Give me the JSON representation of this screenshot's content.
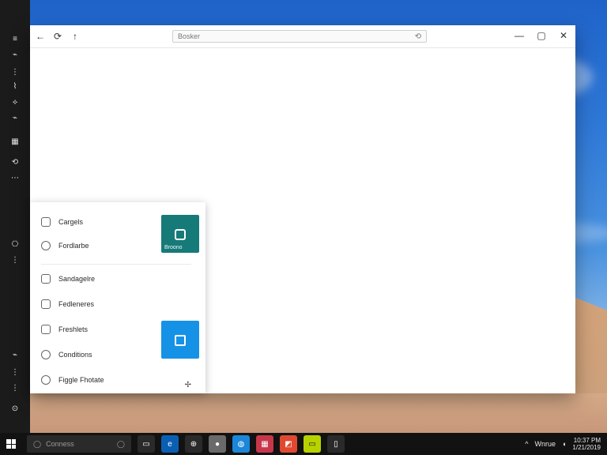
{
  "window": {
    "address_text": "Bosker",
    "nav": {
      "back_icon": "back-icon",
      "refresh_icon": "refresh-icon",
      "forward_icon": "forward-icon"
    },
    "controls": {
      "minimize": "—",
      "maximize": "▢",
      "close": "✕"
    },
    "address_go": "⟲"
  },
  "panel": {
    "items": [
      {
        "label": "Cargels"
      },
      {
        "label": "Fordlarbe"
      },
      {
        "label": "Sandagelre"
      },
      {
        "label": "Fedleneres"
      },
      {
        "label": "Freshlets"
      },
      {
        "label": "Conditions"
      },
      {
        "label": "Figgle Fhotate"
      }
    ],
    "tiles": [
      {
        "label": "Broono",
        "color": "#167a78"
      },
      {
        "label": "",
        "color": "#1592e6"
      }
    ],
    "pin_glyph": "✢"
  },
  "taskbar": {
    "search_text": "Conness",
    "search_right_glyph": "◯",
    "tray_text": "Wnrue",
    "clock_line1": "10:37 PM",
    "clock_line2": "1/21/2019"
  },
  "colors": {
    "taskbar": "#121212",
    "rail": "#1b1b1b",
    "accent_teal": "#167a78",
    "accent_blue": "#1592e6"
  }
}
